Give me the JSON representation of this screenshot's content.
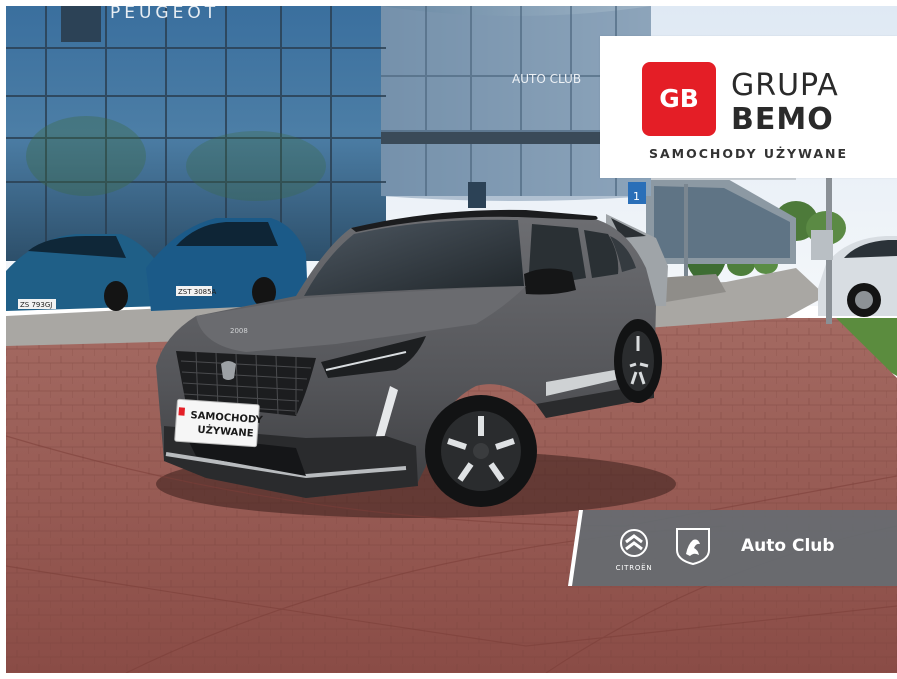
{
  "building": {
    "brand_sign": "PEUGEOT",
    "club_sign": "AUTO CLUB",
    "door_number": "1"
  },
  "car": {
    "model_badge": "2008",
    "dealer_plate": [
      "SAMOCHODY",
      "UŻYWANE"
    ],
    "color": "#5c5d61"
  },
  "logo": {
    "badge_text": "GB",
    "name_line1": "GRUPA",
    "name_line2": "BEMO",
    "subtitle": "SAMOCHODY UŻYWANE",
    "brand_red": "#e41e26"
  },
  "brands_banner": {
    "citroen_label": "CITROËN",
    "club_label": "Auto Club"
  },
  "parked_plates": {
    "left_car": "ZS 793GJ",
    "middle_car": "ZST 3085A"
  }
}
